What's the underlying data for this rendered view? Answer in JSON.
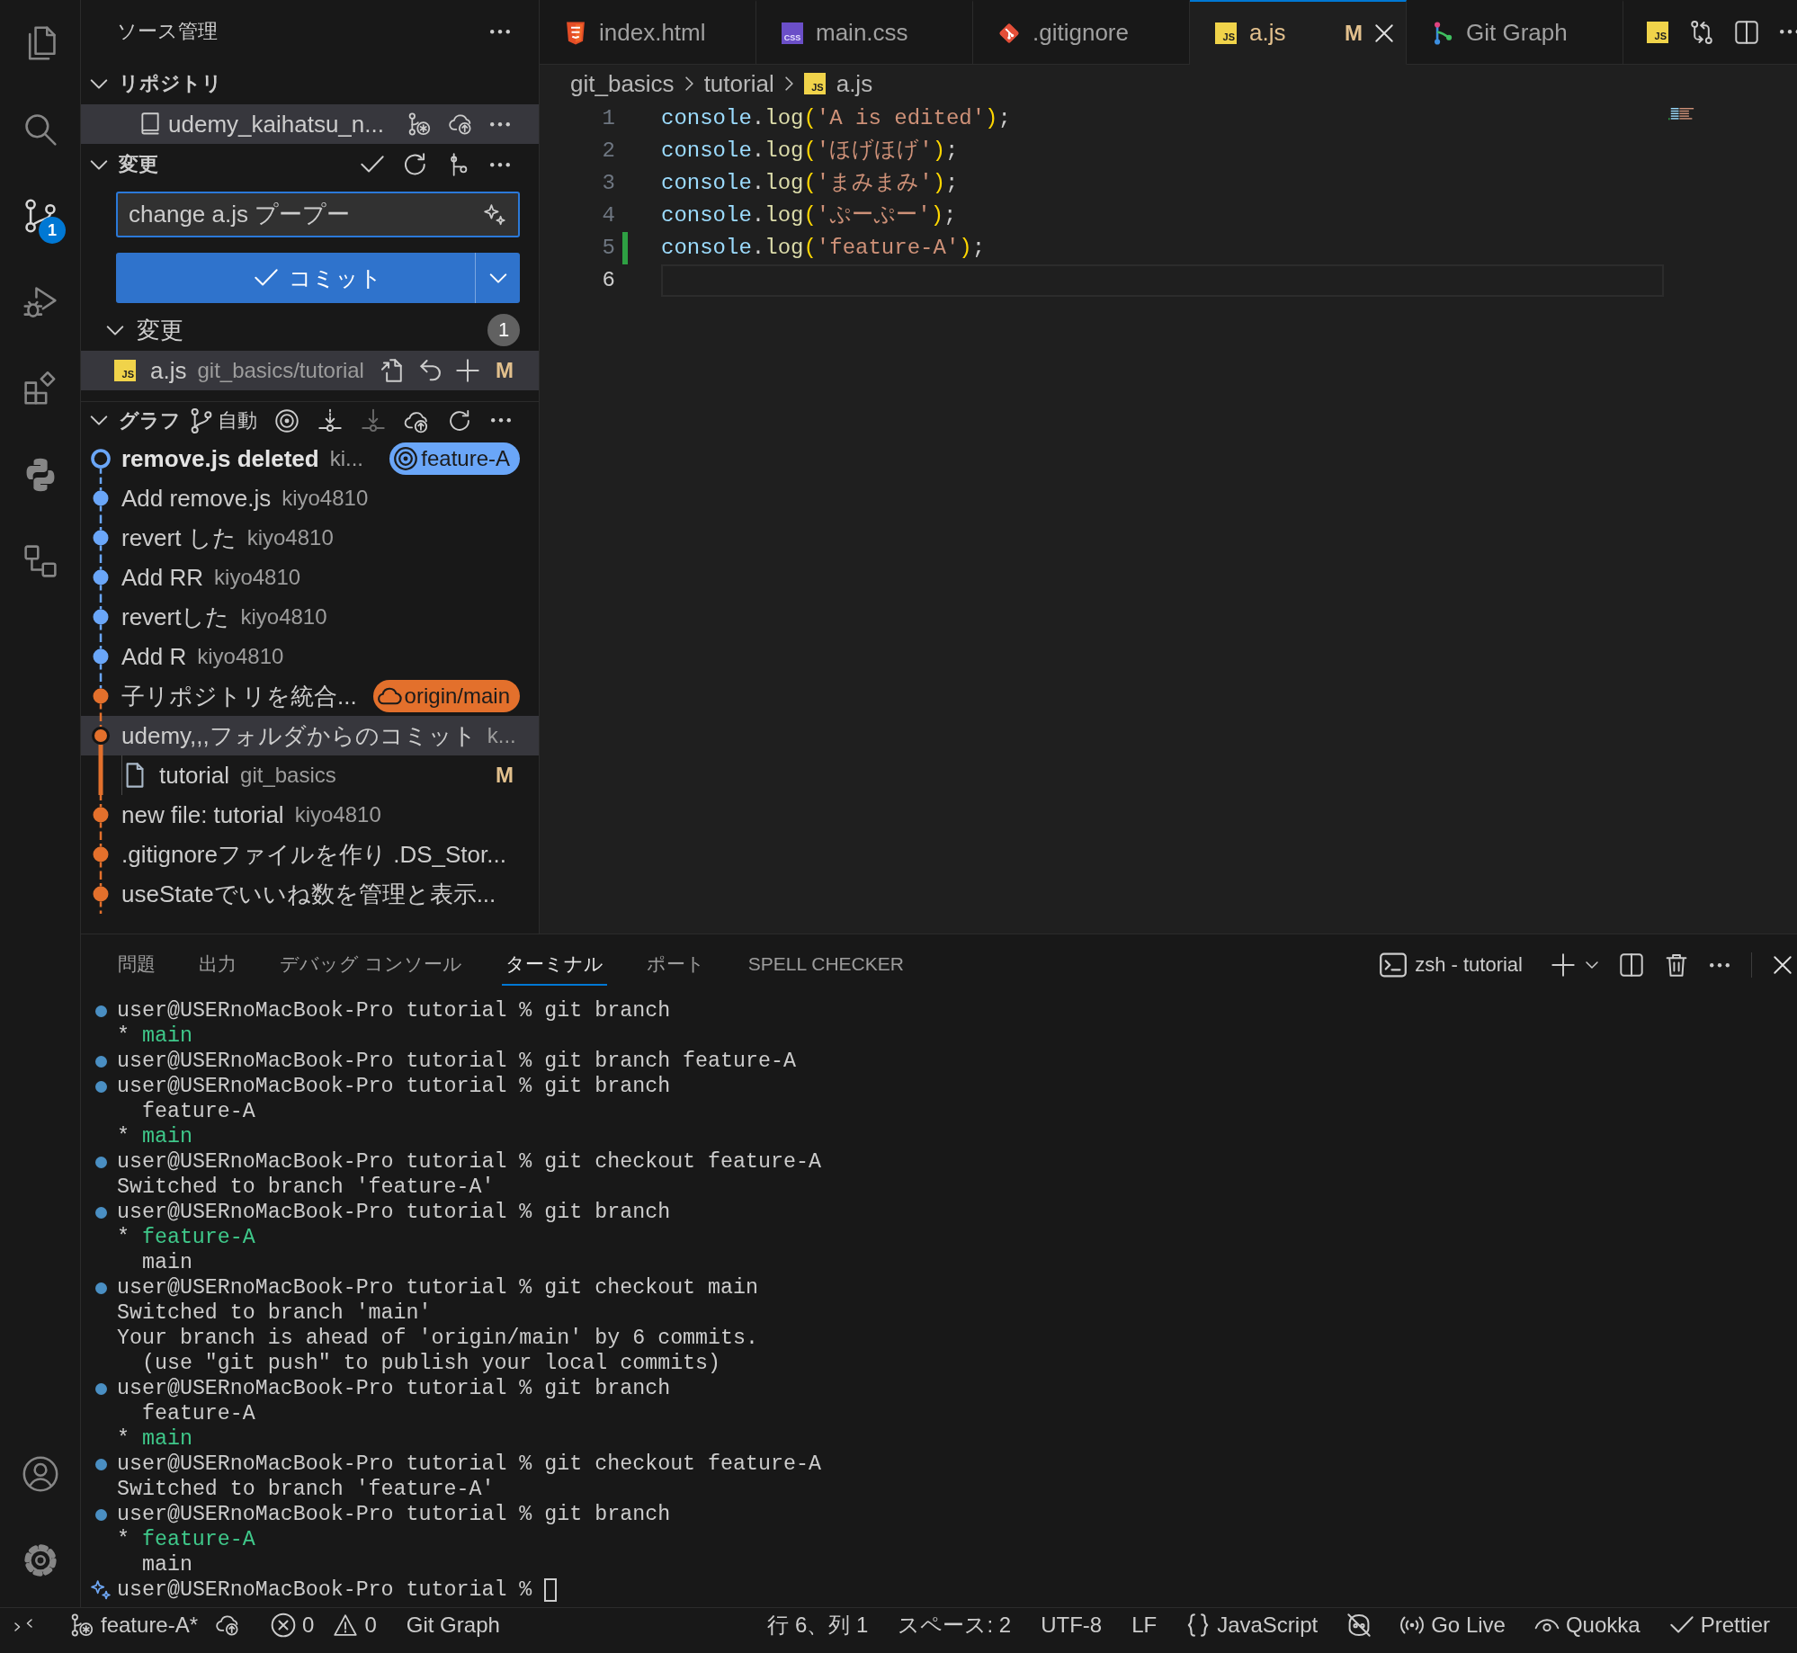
{
  "activity_bar": {
    "items": [
      {
        "kind": "explorer",
        "selected": false
      },
      {
        "kind": "search",
        "selected": false
      },
      {
        "kind": "source-control",
        "selected": true,
        "badge": "1"
      },
      {
        "kind": "run-debug",
        "selected": false
      },
      {
        "kind": "extensions",
        "selected": false
      },
      {
        "kind": "python",
        "selected": false
      },
      {
        "kind": "remote",
        "selected": false
      }
    ]
  },
  "sidebar": {
    "title": "ソース管理",
    "repositories": {
      "title": "リポジトリ",
      "expanded": true,
      "items": [
        {
          "name": "udemy_kaihatsu_n...",
          "selected": true
        }
      ]
    },
    "changes": {
      "title": "変更",
      "expanded": true,
      "commit_message": {
        "value": "change a.js プープー"
      },
      "commit_button": {
        "label": "コミット"
      },
      "groups": [
        {
          "title": "変更",
          "expanded": true,
          "count": "1",
          "files": [
            {
              "name": "a.js",
              "icon_label": "JS",
              "path": "git_basics/tutorial",
              "status": "M",
              "selected": true
            }
          ]
        }
      ]
    },
    "graph": {
      "title": "グラフ",
      "expanded": true,
      "branch_filter": "自動",
      "actions": [
        {
          "kind": "target",
          "disabled": false
        },
        {
          "kind": "fetch",
          "disabled": false
        },
        {
          "kind": "pull",
          "disabled": true
        },
        {
          "kind": "push",
          "disabled": false
        },
        {
          "kind": "refresh",
          "disabled": false
        }
      ],
      "commits": [
        {
          "message": "remove.js deleted",
          "author": "ki...",
          "color": "#6aa6f8",
          "current": true,
          "selected": false,
          "badge": {
            "kind": "branch",
            "label": "feature-A"
          }
        },
        {
          "message": "Add remove.js",
          "author": "kiyo4810",
          "color": "#6aa6f8",
          "current": false,
          "selected": false
        },
        {
          "message": "revert した",
          "author": "kiyo4810",
          "color": "#6aa6f8",
          "current": false,
          "selected": false
        },
        {
          "message": "Add RR",
          "author": "kiyo4810",
          "color": "#6aa6f8",
          "current": false,
          "selected": false
        },
        {
          "message": "revertした",
          "author": "kiyo4810",
          "color": "#6aa6f8",
          "current": false,
          "selected": false
        },
        {
          "message": "Add R",
          "author": "kiyo4810",
          "color": "#6aa6f8",
          "current": false,
          "selected": false
        },
        {
          "message": "子リポジトリを統合...",
          "color": "#e3702c",
          "current": false,
          "selected": false,
          "badge": {
            "kind": "remote",
            "label": "origin/main"
          }
        },
        {
          "message": "udemy,,,フォルダからのコミット",
          "author": "k...",
          "color": "#e3702c",
          "current": false,
          "selected": true,
          "files": [
            {
              "name": "tutorial",
              "path": "git_basics",
              "status": "M"
            }
          ]
        },
        {
          "message": "new file: tutorial",
          "author": "kiyo4810",
          "color": "#e3702c",
          "current": false,
          "selected": false
        },
        {
          "message": ".gitignoreファイルを作り .DS_Stor...",
          "color": "#e3702c",
          "current": false,
          "selected": false
        },
        {
          "message": "useStateでいいね数を管理と表示...",
          "color": "#e3702c",
          "current": false,
          "selected": false
        }
      ]
    }
  },
  "editor": {
    "tabs": [
      {
        "label": "index.html",
        "kind": "html",
        "selected": false
      },
      {
        "label": "main.css",
        "kind": "css",
        "icon_label": "CSS",
        "selected": false
      },
      {
        "label": ".gitignore",
        "kind": "git",
        "selected": false
      },
      {
        "label": "a.js",
        "kind": "js",
        "icon_label": "JS",
        "selected": true,
        "status": "M"
      },
      {
        "label": "Git Graph",
        "kind": "git-graph",
        "selected": false
      }
    ],
    "actions": {
      "icon_label": "JS"
    },
    "breadcrumb": [
      {
        "label": "git_basics",
        "kind": "folder"
      },
      {
        "label": "tutorial",
        "kind": "folder"
      },
      {
        "label": "a.js",
        "kind": "js",
        "icon_label": "JS"
      }
    ],
    "lines": [
      {
        "number": "1",
        "added": false,
        "current": false,
        "tokens": [
          {
            "kind": "variable",
            "text": "console"
          },
          {
            "kind": "punctuation",
            "text": "."
          },
          {
            "kind": "function",
            "text": "log"
          },
          {
            "kind": "bracket",
            "text": "("
          },
          {
            "kind": "string",
            "text": "'A is edited'"
          },
          {
            "kind": "bracket",
            "text": ")"
          },
          {
            "kind": "punctuation",
            "text": ";"
          }
        ]
      },
      {
        "number": "2",
        "added": false,
        "current": false,
        "tokens": [
          {
            "kind": "variable",
            "text": "console"
          },
          {
            "kind": "punctuation",
            "text": "."
          },
          {
            "kind": "function",
            "text": "log"
          },
          {
            "kind": "bracket",
            "text": "("
          },
          {
            "kind": "string",
            "text": "'ほげほげ'"
          },
          {
            "kind": "bracket",
            "text": ")"
          },
          {
            "kind": "punctuation",
            "text": ";"
          }
        ]
      },
      {
        "number": "3",
        "added": false,
        "current": false,
        "tokens": [
          {
            "kind": "variable",
            "text": "console"
          },
          {
            "kind": "punctuation",
            "text": "."
          },
          {
            "kind": "function",
            "text": "log"
          },
          {
            "kind": "bracket",
            "text": "("
          },
          {
            "kind": "string",
            "text": "'まみまみ'"
          },
          {
            "kind": "bracket",
            "text": ")"
          },
          {
            "kind": "punctuation",
            "text": ";"
          }
        ]
      },
      {
        "number": "4",
        "added": false,
        "current": false,
        "tokens": [
          {
            "kind": "variable",
            "text": "console"
          },
          {
            "kind": "punctuation",
            "text": "."
          },
          {
            "kind": "function",
            "text": "log"
          },
          {
            "kind": "bracket",
            "text": "("
          },
          {
            "kind": "string",
            "text": "'ぷーぷー'"
          },
          {
            "kind": "bracket",
            "text": ")"
          },
          {
            "kind": "punctuation",
            "text": ";"
          }
        ]
      },
      {
        "number": "5",
        "added": true,
        "current": false,
        "tokens": [
          {
            "kind": "variable",
            "text": "console"
          },
          {
            "kind": "punctuation",
            "text": "."
          },
          {
            "kind": "function",
            "text": "log"
          },
          {
            "kind": "bracket",
            "text": "("
          },
          {
            "kind": "string",
            "text": "'feature-A'"
          },
          {
            "kind": "bracket",
            "text": ")"
          },
          {
            "kind": "punctuation",
            "text": ";"
          }
        ]
      },
      {
        "number": "6",
        "added": false,
        "current": true
      }
    ]
  },
  "panel": {
    "tabs": [
      {
        "label": "問題",
        "selected": false
      },
      {
        "label": "出力",
        "selected": false
      },
      {
        "label": "デバッグ コンソール",
        "selected": false
      },
      {
        "label": "ターミナル",
        "selected": true
      },
      {
        "label": "ポート",
        "selected": false
      },
      {
        "label": "SPELL CHECKER",
        "selected": false
      }
    ],
    "terminal_name": "zsh - tutorial",
    "lines": [
      {
        "kind": "command",
        "text": "user@USERnoMacBook-Pro tutorial % git branch"
      },
      {
        "kind": "branch",
        "current": true,
        "marker": "*",
        "text": "main"
      },
      {
        "kind": "command",
        "text": "user@USERnoMacBook-Pro tutorial % git branch feature-A"
      },
      {
        "kind": "command",
        "text": "user@USERnoMacBook-Pro tutorial % git branch"
      },
      {
        "kind": "branch",
        "current": false,
        "text": "feature-A"
      },
      {
        "kind": "branch",
        "current": true,
        "marker": "*",
        "text": "main"
      },
      {
        "kind": "command",
        "text": "user@USERnoMacBook-Pro tutorial % git checkout feature-A"
      },
      {
        "kind": "output",
        "text": "Switched to branch 'feature-A'"
      },
      {
        "kind": "command",
        "text": "user@USERnoMacBook-Pro tutorial % git branch"
      },
      {
        "kind": "branch",
        "current": true,
        "marker": "*",
        "text": "feature-A"
      },
      {
        "kind": "branch",
        "current": false,
        "text": "main"
      },
      {
        "kind": "command",
        "text": "user@USERnoMacBook-Pro tutorial % git checkout main"
      },
      {
        "kind": "output",
        "text": "Switched to branch 'main'"
      },
      {
        "kind": "output",
        "text": "Your branch is ahead of 'origin/main' by 6 commits."
      },
      {
        "kind": "hint",
        "text": "(use \"git push\" to publish your local commits)"
      },
      {
        "kind": "command",
        "text": "user@USERnoMacBook-Pro tutorial % git branch"
      },
      {
        "kind": "branch",
        "current": false,
        "text": "feature-A"
      },
      {
        "kind": "branch",
        "current": true,
        "marker": "*",
        "text": "main"
      },
      {
        "kind": "command",
        "text": "user@USERnoMacBook-Pro tutorial % git checkout feature-A"
      },
      {
        "kind": "output",
        "text": "Switched to branch 'feature-A'"
      },
      {
        "kind": "command",
        "text": "user@USERnoMacBook-Pro tutorial % git branch"
      },
      {
        "kind": "branch",
        "current": true,
        "marker": "*",
        "text": "feature-A"
      },
      {
        "kind": "branch",
        "current": false,
        "text": "main"
      },
      {
        "kind": "prompt",
        "text": "user@USERnoMacBook-Pro tutorial %"
      }
    ]
  },
  "status_bar": {
    "branch": "feature-A*",
    "errors": "0",
    "warnings": "0",
    "git_graph": "Git Graph",
    "cursor": "行 6、列 1",
    "indentation": "スペース: 2",
    "encoding": "UTF-8",
    "line_ending": "LF",
    "language": "JavaScript",
    "go_live": "Go Live",
    "quokka": "Quokka",
    "prettier": "Prettier"
  }
}
